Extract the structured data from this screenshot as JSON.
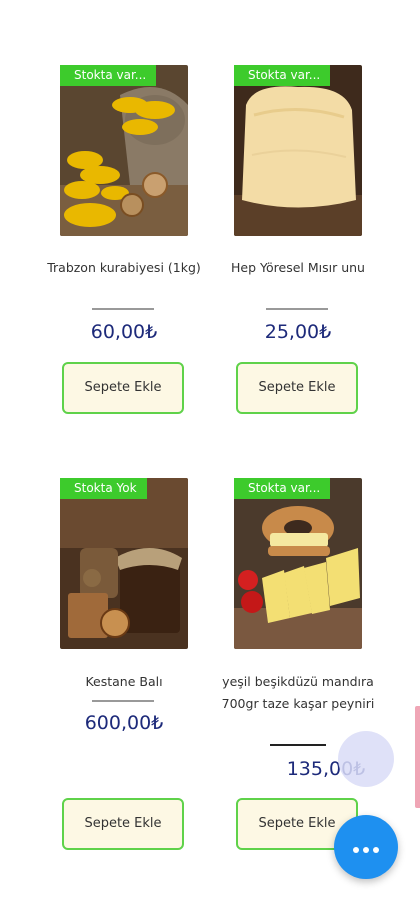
{
  "products": [
    {
      "badge": "Stokta var...",
      "name": "Trabzon kurabiyesi (1kg)",
      "price": "60,00₺",
      "button": "Sepete Ekle",
      "image": "cookies-image"
    },
    {
      "badge": "Stokta var...",
      "name": "Hep Yöresel Mısır unu",
      "price": "25,00₺",
      "button": "Sepete Ekle",
      "image": "corn-flour-image"
    },
    {
      "badge": "Stokta Yok",
      "name": "Kestane Balı",
      "price": "600,00₺",
      "button": "Sepete Ekle",
      "image": "chestnut-honey-image"
    },
    {
      "badge": "Stokta var...",
      "name": "yeşil beşikdüzü mandıra 700gr taze kaşar peyniri",
      "price": "135,00₺",
      "button": "Sepete Ekle",
      "image": "kashar-cheese-image"
    }
  ],
  "colors": {
    "badge_green": "#3dcb2c",
    "price_blue": "#1d2a7a",
    "button_border": "#5fd24a",
    "button_bg": "#fdf8e4",
    "fab_blue": "#1e90f0"
  },
  "fab": {
    "icon": "more-dots-icon"
  }
}
